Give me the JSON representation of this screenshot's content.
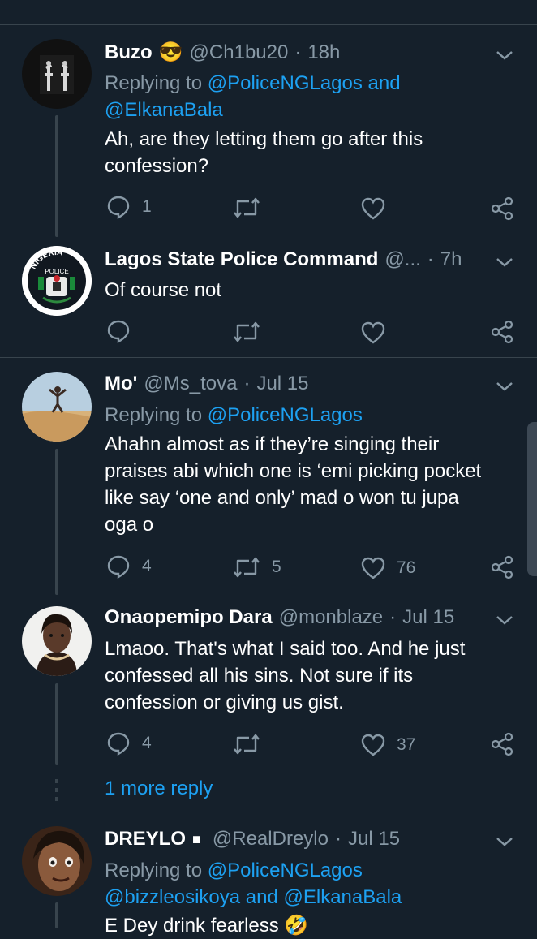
{
  "tweets": [
    {
      "name": "Buzo",
      "emoji": "😎",
      "handle": "@Ch1bu20",
      "time": "18h",
      "replying_prefix": "Replying to",
      "replying_line1": "@PoliceNGLagos and",
      "replying_line2": "@ElkanaBala",
      "text_line1": "Ah, are they letting them go after this",
      "text_line2": "confession?",
      "replies": "1"
    },
    {
      "name": "Lagos State Police Command",
      "handle": "@...",
      "time": "7h",
      "text_line1": "Of course not",
      "avatar_text_top": "NIGERIA",
      "avatar_text_mid": "POLICE"
    },
    {
      "name": "Mo'",
      "handle": "@Ms_tova",
      "time": "Jul 15",
      "replying_prefix": "Replying to",
      "replying_line1": "@PoliceNGLagos",
      "text_line1": "Ahahn almost as if they’re singing their",
      "text_line2": "praises abi which one is ‘emi picking pocket",
      "text_line3": "like say ‘one and only’ mad o won tu jupa",
      "text_line4": "oga o",
      "replies": "4",
      "retweets": "5",
      "likes": "76"
    },
    {
      "name": "Onaopemipo Dara",
      "handle": "@monblaze",
      "time": "Jul 15",
      "text_line1": "Lmaoo. That's what I said too. And he just",
      "text_line2": "confessed all his sins. Not sure if its",
      "text_line3": "confession or giving us gist.",
      "replies": "4",
      "likes": "37"
    },
    {
      "name": "DREYLO",
      "badge": "■",
      "handle": "@RealDreylo",
      "time": "Jul 15",
      "replying_prefix": "Replying to",
      "replying_line1": "@PoliceNGLagos",
      "replying_line2a": "@bizzleosikoya",
      "replying_line2b": "and",
      "replying_line2c": "@ElkanaBala",
      "text_line1": "E Dey drink fearless 🤣"
    }
  ],
  "more_reply": "1 more reply",
  "separator": "·",
  "icons": [
    "reply-icon",
    "retweet-icon",
    "like-icon",
    "share-icon",
    "chevron-down-icon"
  ],
  "colors": {
    "background": "#15202b",
    "muted": "#8899a6",
    "link": "#1da1f2",
    "divider": "#38444d"
  }
}
